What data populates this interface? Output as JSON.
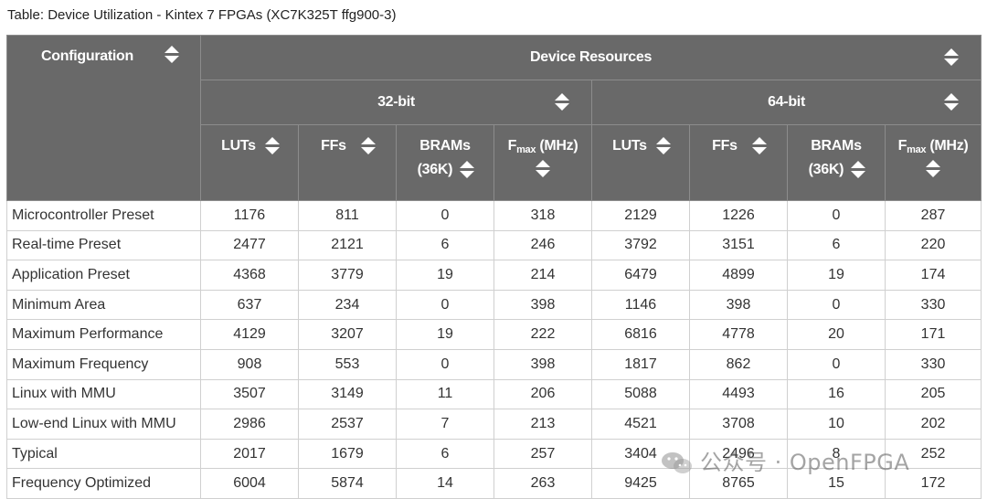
{
  "caption": "Table: Device Utilization - Kintex 7 FPGAs (XC7K325T ffg900-3)",
  "header": {
    "configuration": "Configuration",
    "device_resources": "Device Resources",
    "group_32": "32-bit",
    "group_64": "64-bit",
    "luts": "LUTs",
    "ffs": "FFs",
    "brams": "BRAMs",
    "brams_unit": "(36K)",
    "fmax_f": "F",
    "fmax_sub": "max",
    "fmax_unit": " (MHz)"
  },
  "rows": [
    {
      "name": "Microcontroller Preset",
      "v": [
        "1176",
        "811",
        "0",
        "318",
        "2129",
        "1226",
        "0",
        "287"
      ]
    },
    {
      "name": "Real-time Preset",
      "v": [
        "2477",
        "2121",
        "6",
        "246",
        "3792",
        "3151",
        "6",
        "220"
      ]
    },
    {
      "name": "Application Preset",
      "v": [
        "4368",
        "3779",
        "19",
        "214",
        "6479",
        "4899",
        "19",
        "174"
      ]
    },
    {
      "name": "Minimum Area",
      "v": [
        "637",
        "234",
        "0",
        "398",
        "1146",
        "398",
        "0",
        "330"
      ]
    },
    {
      "name": "Maximum Performance",
      "v": [
        "4129",
        "3207",
        "19",
        "222",
        "6816",
        "4778",
        "20",
        "171"
      ]
    },
    {
      "name": "Maximum Frequency",
      "v": [
        "908",
        "553",
        "0",
        "398",
        "1817",
        "862",
        "0",
        "330"
      ]
    },
    {
      "name": "Linux with MMU",
      "v": [
        "3507",
        "3149",
        "11",
        "206",
        "5088",
        "4493",
        "16",
        "205"
      ]
    },
    {
      "name": "Low-end Linux with MMU",
      "v": [
        "2986",
        "2537",
        "7",
        "213",
        "4521",
        "3708",
        "10",
        "202"
      ]
    },
    {
      "name": "Typical",
      "v": [
        "2017",
        "1679",
        "6",
        "257",
        "3404",
        "2496",
        "8",
        "252"
      ]
    },
    {
      "name": "Frequency Optimized",
      "v": [
        "6004",
        "5874",
        "14",
        "263",
        "9425",
        "8765",
        "15",
        "172"
      ]
    }
  ],
  "watermark": "公众号 · OpenFPGA",
  "colors": {
    "header_bg": "#696969",
    "border": "#d0d0d0"
  }
}
